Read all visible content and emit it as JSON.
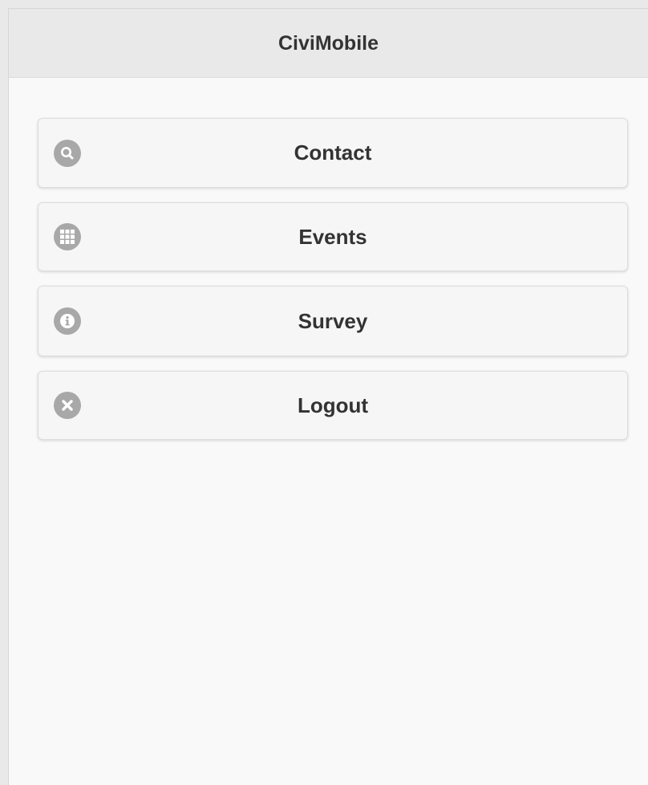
{
  "header": {
    "title": "CiviMobile"
  },
  "menu": {
    "items": [
      {
        "label": "Contact",
        "icon": "search-icon"
      },
      {
        "label": "Events",
        "icon": "grid-icon"
      },
      {
        "label": "Survey",
        "icon": "info-icon"
      },
      {
        "label": "Logout",
        "icon": "close-icon"
      }
    ]
  },
  "colors": {
    "header_bg": "#e9e9e9",
    "page_bg": "#f9f9f9",
    "button_bg": "#f6f6f6",
    "icon_bg": "#a8a8a8",
    "text": "#333333"
  }
}
